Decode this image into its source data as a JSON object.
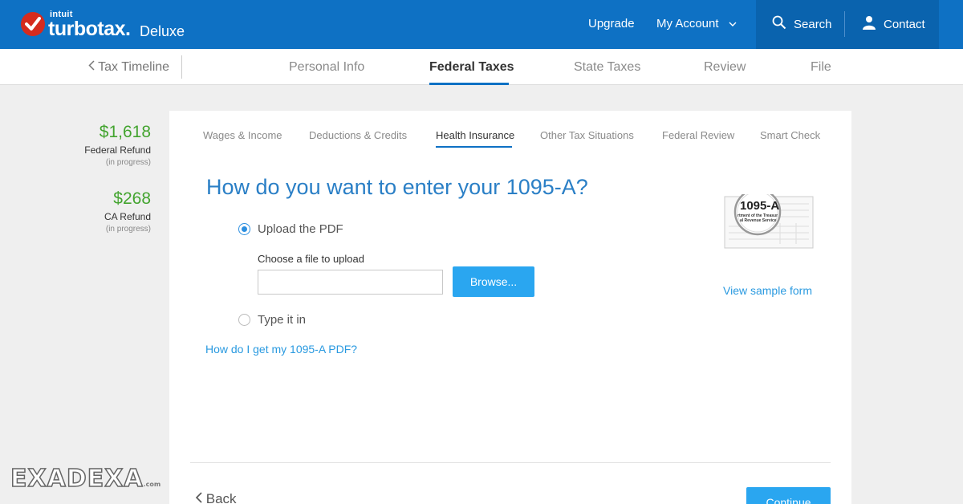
{
  "header": {
    "brand_small": "intuit",
    "brand_name": "turbotax.",
    "edition": "Deluxe",
    "upgrade": "Upgrade",
    "my_account": "My Account",
    "search": "Search",
    "contact": "Contact"
  },
  "stepbar": {
    "back": "Tax Timeline",
    "steps": [
      "Personal Info",
      "Federal Taxes",
      "State Taxes",
      "Review",
      "File"
    ],
    "active_step": "Federal Taxes"
  },
  "refunds": [
    {
      "amount": "$1,618",
      "label": "Federal Refund",
      "status": "(in progress)"
    },
    {
      "amount": "$268",
      "label": "CA Refund",
      "status": "(in progress)"
    }
  ],
  "subtabs": [
    "Wages & Income",
    "Deductions & Credits",
    "Health Insurance",
    "Other Tax Situations",
    "Federal Review",
    "Smart Check"
  ],
  "active_subtab": "Health Insurance",
  "main": {
    "question": "How do you want to enter your 1095-A?",
    "option_upload": "Upload the PDF",
    "choose_file": "Choose a file to upload",
    "file_value": "",
    "browse": "Browse...",
    "option_type": "Type it in",
    "help_link": "How do I get my 1095-A PDF?",
    "view_sample": "View sample form",
    "form_badge": "1095-A",
    "form_caption_1": "rtment of the Treasur",
    "form_caption_2": "al Revenue Service",
    "selected_option": "upload"
  },
  "footer": {
    "back": "Back",
    "continue": "Continue"
  },
  "watermark": {
    "text": "EXADEXA",
    "sub": ".com"
  },
  "colors": {
    "header_blue": "#0e71c4",
    "accent_blue": "#2aa6f0",
    "refund_green": "#43a42f",
    "logo_red": "#d52b1e"
  }
}
